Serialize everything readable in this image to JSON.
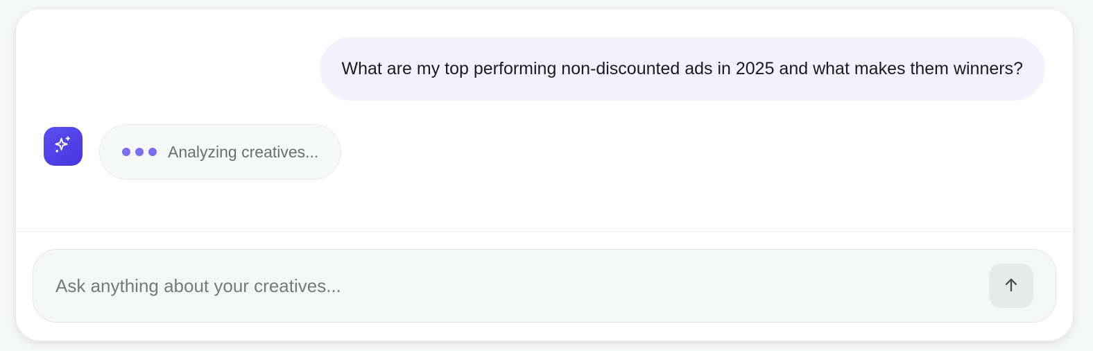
{
  "chat": {
    "user_message": "What are my top performing non-discounted ads in 2025 and what makes them winners?",
    "assistant_status": "Analyzing creatives...",
    "assistant_avatar_icon": "sparkles-icon",
    "typing_indicator_icon": "typing-dots-icon"
  },
  "composer": {
    "placeholder": "Ask anything about your creatives...",
    "value": "",
    "send_icon": "arrow-up-icon"
  },
  "colors": {
    "accent": "#4f44ea",
    "user_bubble_bg": "#f3f1fd",
    "typing_dot": "#7a6ef0"
  }
}
